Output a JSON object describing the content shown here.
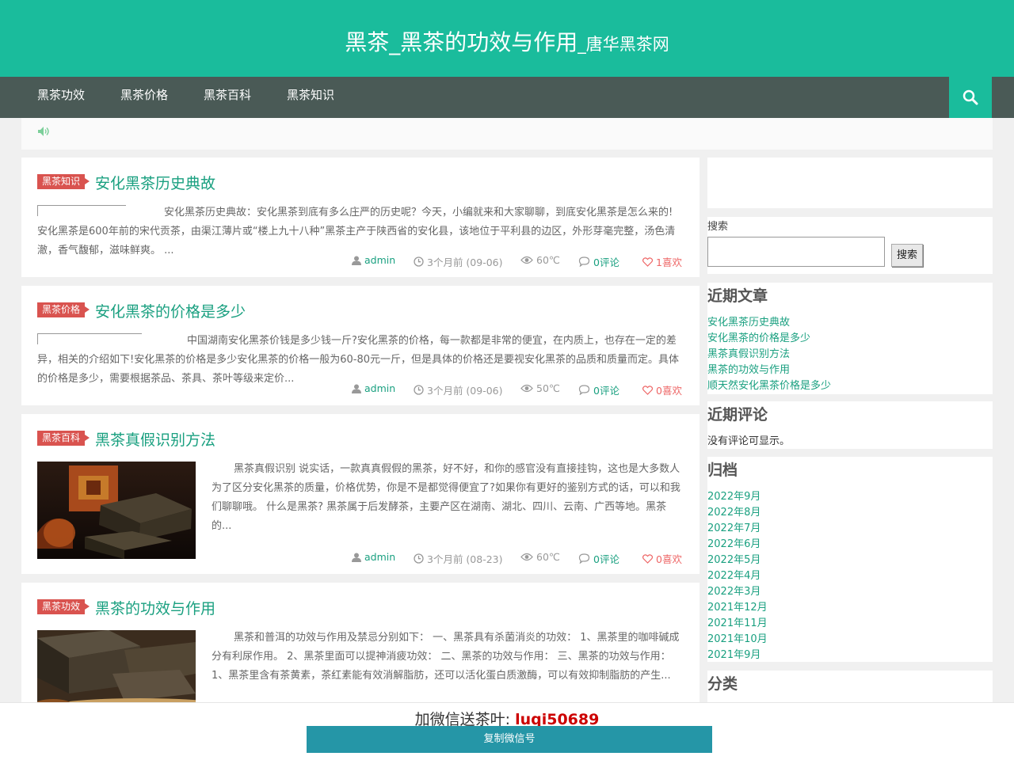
{
  "header": {
    "title_main": "黑茶_黑茶的功效与作用",
    "title_sub": "_唐华黑茶网"
  },
  "nav": {
    "items": [
      "黑茶功效",
      "黑茶价格",
      "黑茶百科",
      "黑茶知识"
    ]
  },
  "posts": [
    {
      "category": "黑茶知识",
      "title": "安化黑茶历史典故",
      "excerpt": "安化黑茶历史典故：安化黑茶到底有多么庄严的历史呢？今天，小编就来和大家聊聊，到底安化黑茶是怎么来的! 安化黑茶是600年前的宋代贡茶，由渠江薄片或“楼上九十八种”黑茶主产于陕西省的安化县，该地位于平利县的边区，外形芽毫完整，汤色清澈，香气馥郁，滋味鲜爽。     ...",
      "author": "admin",
      "time": "3个月前 (09-06)",
      "views": "60℃",
      "comments": "0评论",
      "likes": "1喜欢"
    },
    {
      "category": "黑茶价格",
      "title": "安化黑茶的价格是多少",
      "excerpt": "中国湖南安化黑茶价钱是多少钱一斤?安化黑茶的价格，每一款都是非常的便宜，在内质上，也存在一定的差异，相关的介绍如下!安化黑茶的价格是多少安化黑茶的价格一般为60-80元一斤，但是具体的价格还是要视安化黑茶的品质和质量而定。具体的价格是多少，需要根据茶品、茶具、茶叶等级来定价...",
      "author": "admin",
      "time": "3个月前 (09-06)",
      "views": "50℃",
      "comments": "0评论",
      "likes": "0喜欢"
    },
    {
      "category": "黑茶百科",
      "title": "黑茶真假识别方法",
      "excerpt": "黑茶真假识别 说实话，一款真真假假的黑茶，好不好，和你的感官没有直接挂钩，这也是大多数人为了区分安化黑茶的质量，价格优势，你是不是都觉得便宜了?如果你有更好的鉴别方式的话，可以和我们聊聊哦。 什么是黑茶? 黑茶属于后发酵茶，主要产区在湖南、湖北、四川、云南、广西等地。黑茶的...",
      "author": "admin",
      "time": "3个月前 (08-23)",
      "views": "60℃",
      "comments": "0评论",
      "likes": "0喜欢"
    },
    {
      "category": "黑茶功效",
      "title": "黑茶的功效与作用",
      "excerpt": "黑茶和普洱的功效与作用及禁忌分别如下： 一、黑茶具有杀菌消炎的功效： 1、黑茶里的咖啡碱成分有利尿作用。 2、黑茶里面可以提神消疲功效： 二、黑茶的功效与作用： 三、黑茶的功效与作用： 1、黑茶里含有茶黄素，茶红素能有效消解脂肪，还可以活化蛋白质激酶，可以有效抑制脂肪的产生..."
    }
  ],
  "sidebar": {
    "search_label": "搜索",
    "search_value": "",
    "search_button": "搜索",
    "recent_posts_title": "近期文章",
    "recent_posts": [
      "安化黑茶历史典故",
      "安化黑茶的价格是多少",
      "黑茶真假识别方法",
      "黑茶的功效与作用",
      "顺天然安化黑茶价格是多少"
    ],
    "recent_comments_title": "近期评论",
    "recent_comments_empty": "没有评论可显示。",
    "archives_title": "归档",
    "archives": [
      "2022年9月",
      "2022年8月",
      "2022年7月",
      "2022年6月",
      "2022年5月",
      "2022年4月",
      "2022年3月",
      "2021年12月",
      "2021年11月",
      "2021年10月",
      "2021年9月"
    ],
    "categories_title": "分类"
  },
  "wechat": {
    "prefix": "加微信送茶叶: ",
    "id": "luqi50689",
    "copy_button": "复制微信号"
  },
  "colors": {
    "brand": "#1abc9c",
    "nav": "#4a5a56",
    "badge": "#d9534f",
    "link": "#1aa080",
    "copy": "#2596a7",
    "wechat_id": "#cc0000"
  },
  "icons": [
    "search-icon",
    "speaker-icon",
    "user-icon",
    "clock-icon",
    "eye-icon",
    "comment-icon",
    "heart-icon"
  ]
}
